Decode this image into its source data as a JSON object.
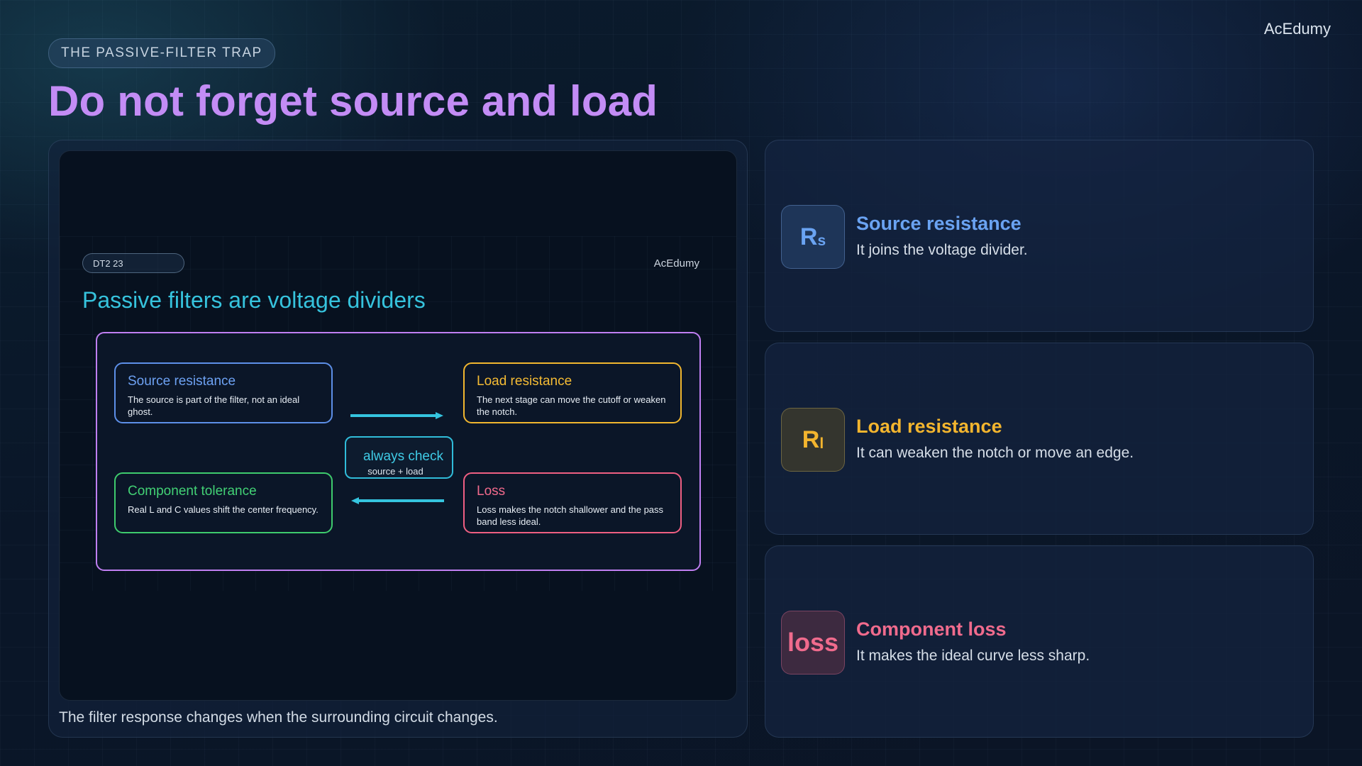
{
  "brand": "AcEdumy",
  "kicker": "THE PASSIVE-FILTER TRAP",
  "title": "Do not forget source and load",
  "slide": {
    "tag": "DT2 23",
    "brand": "AcEdumy",
    "title": "Passive filters are voltage dividers",
    "boxes": {
      "source": {
        "title": "Source resistance",
        "desc": "The source is part of the filter, not an ideal ghost."
      },
      "load": {
        "title": "Load resistance",
        "desc": "The next stage can move the cutoff or weaken the notch."
      },
      "tolerance": {
        "title": "Component tolerance",
        "desc": "Real L and C values shift the center frequency."
      },
      "loss": {
        "title": "Loss",
        "desc": "Loss makes the notch shallower and the pass band less ideal."
      }
    },
    "center": {
      "title": "always check",
      "subtitle": "source + load"
    }
  },
  "caption": "The filter response changes when the surrounding circuit changes.",
  "cards": [
    {
      "badge_main": "R",
      "badge_sub": "s",
      "title": "Source resistance",
      "desc": "It joins the voltage divider."
    },
    {
      "badge_main": "R",
      "badge_sub": "l",
      "title": "Load resistance",
      "desc": "It can weaken the notch or move an edge."
    },
    {
      "badge_main": "loss",
      "title": "Component loss",
      "desc": "It makes the ideal curve less sharp."
    }
  ],
  "colors": {
    "title": "#c38cf5",
    "source": "#6aa3f2",
    "load": "#f3b52e",
    "loss": "#f06b8d",
    "tolerance": "#42d175",
    "accent": "#36c3dd"
  }
}
